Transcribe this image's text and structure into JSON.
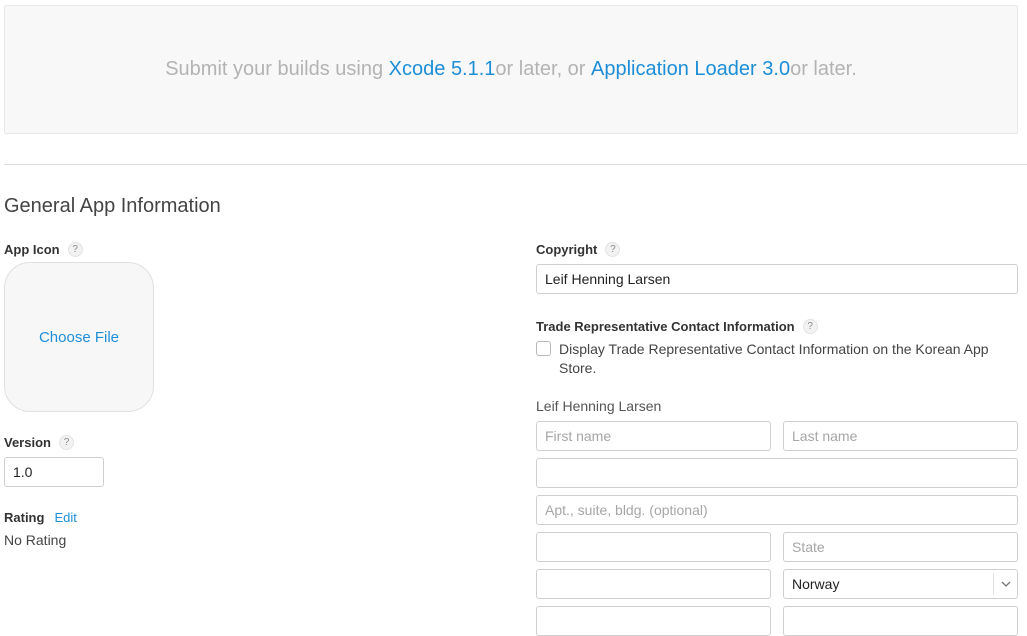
{
  "banner": {
    "prefix": "Submit your builds using ",
    "xcode_link": "Xcode 5.1.1",
    "middle": " or later, or ",
    "loader_link": "Application Loader 3.0",
    "suffix": " or later."
  },
  "section": {
    "title": "General App Information"
  },
  "app_icon": {
    "label": "App Icon",
    "help": "?",
    "choose_file": "Choose File"
  },
  "version": {
    "label": "Version",
    "help": "?",
    "value": "1.0"
  },
  "rating": {
    "label": "Rating",
    "edit": "Edit",
    "value": "No Rating"
  },
  "copyright": {
    "label": "Copyright",
    "help": "?",
    "value": "Leif Henning Larsen"
  },
  "trade_rep": {
    "label": "Trade Representative Contact Information",
    "help": "?",
    "checkbox_label": "Display Trade Representative Contact Information on the Korean App Store.",
    "checked": false,
    "name": "Leif Henning Larsen",
    "first_name_placeholder": "First name",
    "last_name_placeholder": "Last name",
    "address_line1": "",
    "address_line2_placeholder": "Apt., suite, bldg. (optional)",
    "city": "",
    "state_placeholder": "State",
    "postal_code": "",
    "country": "Norway",
    "chevron_icon": "chevron-down-icon"
  }
}
